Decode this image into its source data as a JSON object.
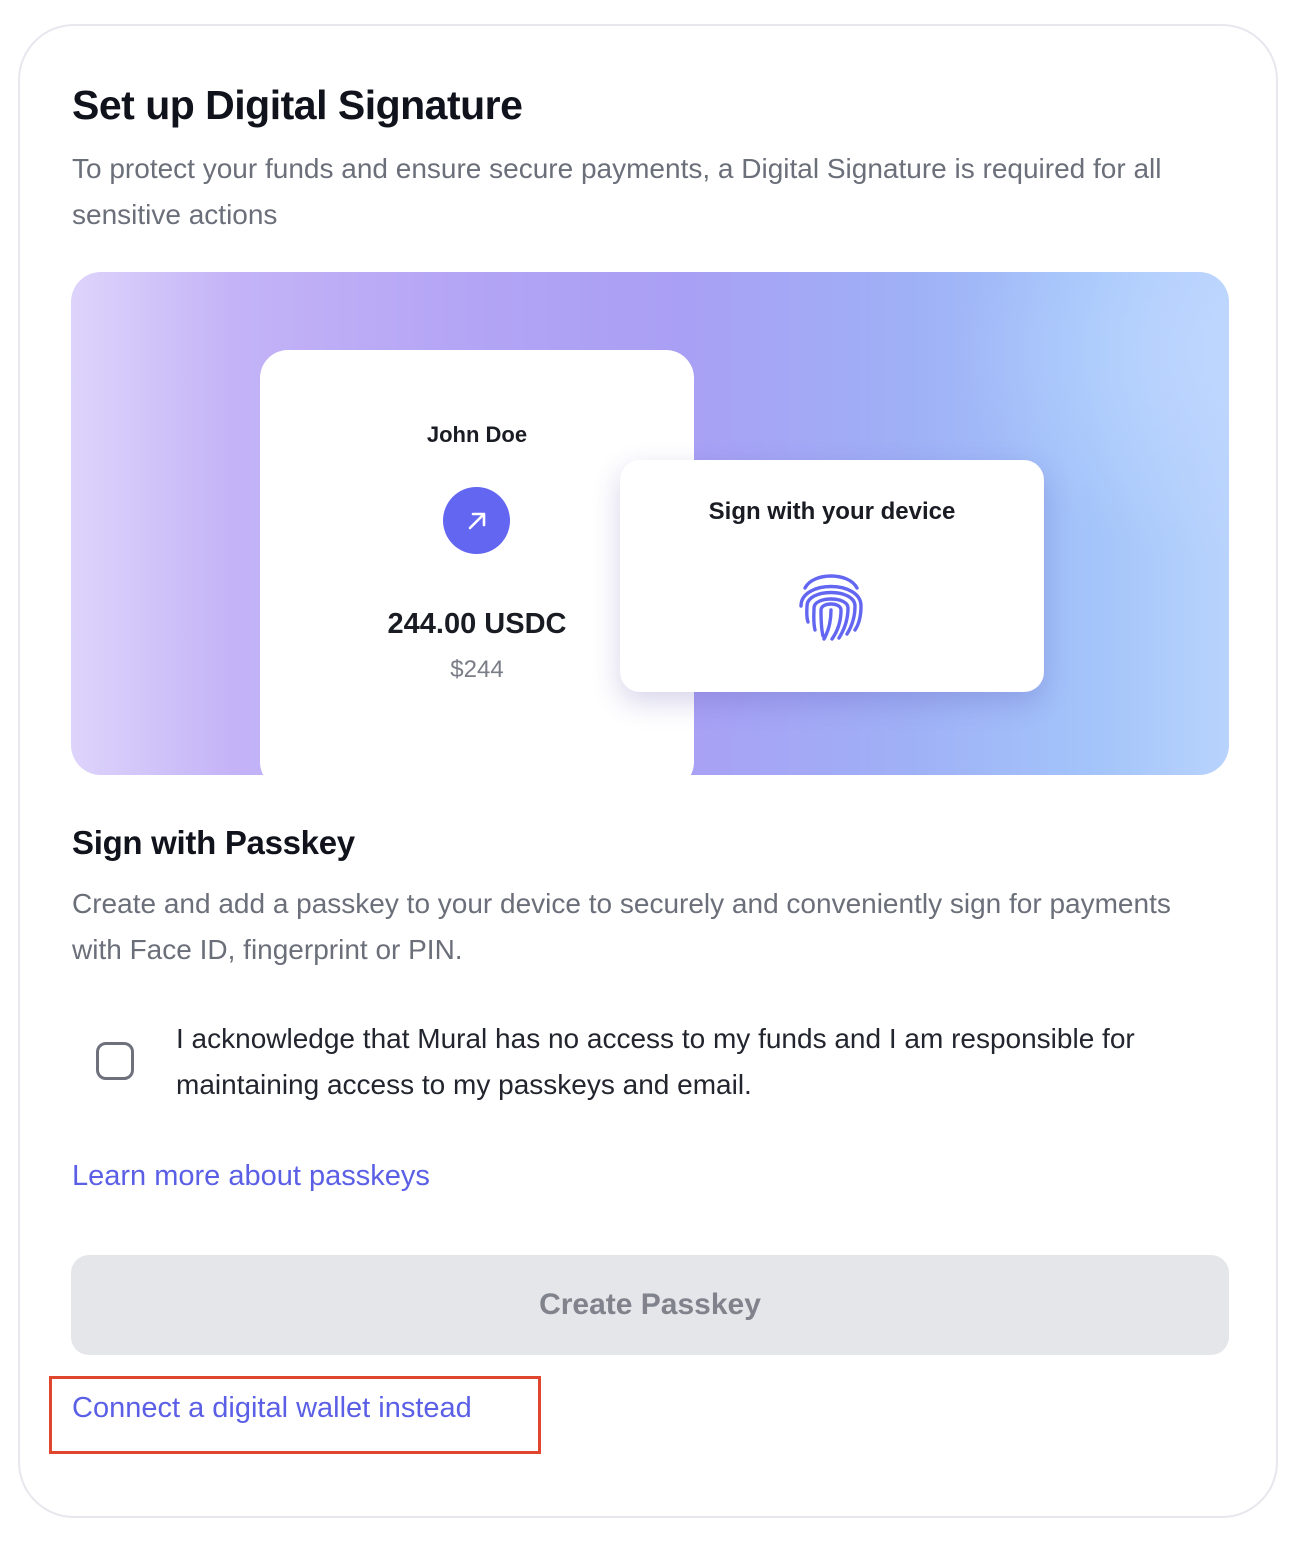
{
  "header": {
    "title": "Set up Digital Signature",
    "subtitle": "To protect your funds and ensure secure payments, a Digital Signature is required for all sensitive actions"
  },
  "illustration": {
    "payment_card": {
      "name": "John Doe",
      "icon": "arrow-up-right-icon",
      "amount": "244.00 USDC",
      "usd_value": "$244"
    },
    "sign_card": {
      "title": "Sign with your device",
      "icon": "fingerprint-icon"
    }
  },
  "passkey": {
    "title": "Sign with Passkey",
    "description": "Create and add a passkey to your device to securely and conveniently sign for payments with Face ID, fingerprint or PIN.",
    "acknowledgement": "I acknowledge that Mural has no access to my funds and I am responsible for maintaining access to my passkeys and email.",
    "acknowledged": false,
    "learn_more": "Learn more about passkeys",
    "create_button": "Create Passkey",
    "create_button_disabled": true,
    "alt_link": "Connect a digital wallet instead"
  },
  "colors": {
    "accent": "#6366f1",
    "link": "#5b5fe6",
    "highlight": "#e0452e",
    "disabled_button": "#e5e6ea"
  }
}
